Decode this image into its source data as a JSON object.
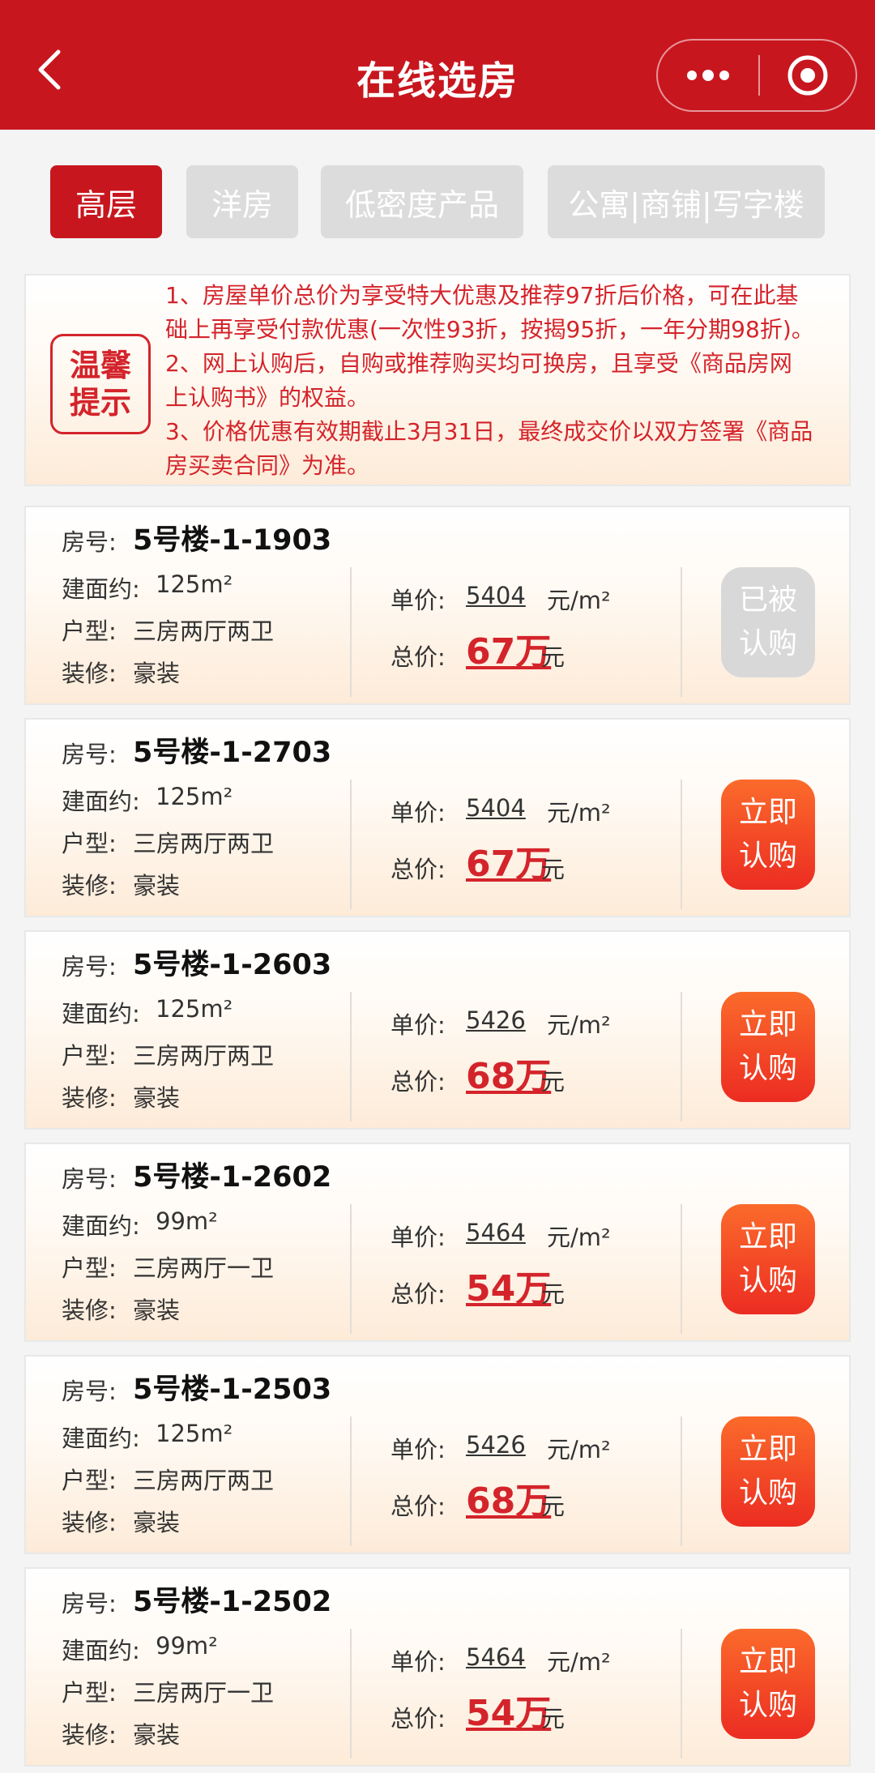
{
  "navbar": {
    "title": "在线选房"
  },
  "tabs": [
    {
      "label": "高层",
      "active": true
    },
    {
      "label": "洋房",
      "active": false
    },
    {
      "label": "低密度产品",
      "active": false
    },
    {
      "label": "公寓|商铺|写字楼",
      "active": false
    }
  ],
  "notice": {
    "badge_line1": "温馨",
    "badge_line2": "提示",
    "lines": [
      "1、房屋单价总价为享受特大优惠及推荐97折后价格，可在此基",
      "础上再享受付款优惠(一次性93折，按揭95折，一年分期98折)。",
      "2、网上认购后，自购或推荐购买均可换房，且享受《商品房网",
      "上认购书》的权益。",
      "3、价格优惠有效期截止3月31日，最终成交价以双方签署《商品",
      "房买卖合同》为准。"
    ]
  },
  "labels": {
    "room_no": "房号:",
    "area": "建面约:",
    "type": "户型:",
    "decoration": "装修:",
    "unit_price": "单价:",
    "total_price": "总价:",
    "unit_suffix": "元/m²",
    "total_suffix": "元"
  },
  "houses": [
    {
      "room": "5号楼-1-1903",
      "area": "125m²",
      "type": "三房两厅两卫",
      "decoration": "豪装",
      "unit_price": "5404",
      "total": "67万",
      "status": "sold",
      "btn_line1": "已被",
      "btn_line2": "认购"
    },
    {
      "room": "5号楼-1-2703",
      "area": "125m²",
      "type": "三房两厅两卫",
      "decoration": "豪装",
      "unit_price": "5404",
      "total": "67万",
      "status": "available",
      "btn_line1": "立即",
      "btn_line2": "认购"
    },
    {
      "room": "5号楼-1-2603",
      "area": "125m²",
      "type": "三房两厅两卫",
      "decoration": "豪装",
      "unit_price": "5426",
      "total": "68万",
      "status": "available",
      "btn_line1": "立即",
      "btn_line2": "认购"
    },
    {
      "room": "5号楼-1-2602",
      "area": "99m²",
      "type": "三房两厅一卫",
      "decoration": "豪装",
      "unit_price": "5464",
      "total": "54万",
      "status": "available",
      "btn_line1": "立即",
      "btn_line2": "认购"
    },
    {
      "room": "5号楼-1-2503",
      "area": "125m²",
      "type": "三房两厅两卫",
      "decoration": "豪装",
      "unit_price": "5426",
      "total": "68万",
      "status": "available",
      "btn_line1": "立即",
      "btn_line2": "认购"
    },
    {
      "room": "5号楼-1-2502",
      "area": "99m²",
      "type": "三房两厅一卫",
      "decoration": "豪装",
      "unit_price": "5464",
      "total": "54万",
      "status": "available",
      "btn_line1": "立即",
      "btn_line2": "认购"
    }
  ],
  "colors": {
    "brand_red": "#c8161e",
    "price_red": "#d4242b",
    "button_orange": "#f45a27",
    "disabled_gray": "#d8d8d8"
  },
  "icons": {
    "back": "chevron-left-icon",
    "more": "more-dots-icon",
    "close": "target-close-icon"
  }
}
